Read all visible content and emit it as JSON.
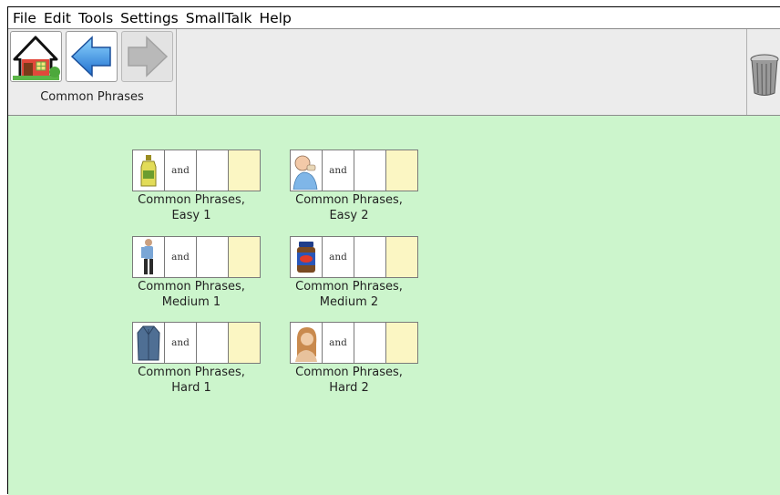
{
  "menu": [
    "File",
    "Edit",
    "Tools",
    "Settings",
    "SmallTalk",
    "Help"
  ],
  "breadcrumb": "Common Phrases",
  "colors": {
    "content_bg": "#ccf5cc",
    "toolbar_bg": "#ececec",
    "strip_end_cell": "#fbf6c3"
  },
  "icons": {
    "home": "house-icon",
    "back": "back-arrow-icon",
    "forward": "forward-arrow-icon",
    "trash": "trash-can-icon"
  },
  "tiles": [
    {
      "caption_line1": "Common Phrases,",
      "caption_line2": "Easy 1",
      "connector": "and",
      "picture": "oil-bottle-icon"
    },
    {
      "caption_line1": "Common Phrases,",
      "caption_line2": "Easy 2",
      "connector": "and",
      "picture": "man-eating-icon"
    },
    {
      "caption_line1": "Common Phrases,",
      "caption_line2": "Medium 1",
      "connector": "and",
      "picture": "standing-man-icon"
    },
    {
      "caption_line1": "Common Phrases,",
      "caption_line2": "Medium 2",
      "connector": "and",
      "picture": "peanut-butter-jar-icon"
    },
    {
      "caption_line1": "Common Phrases,",
      "caption_line2": "Hard 1",
      "connector": "and",
      "picture": "coat-icon"
    },
    {
      "caption_line1": "Common Phrases,",
      "caption_line2": "Hard 2",
      "connector": "and",
      "picture": "woman-with-hair-icon"
    }
  ]
}
